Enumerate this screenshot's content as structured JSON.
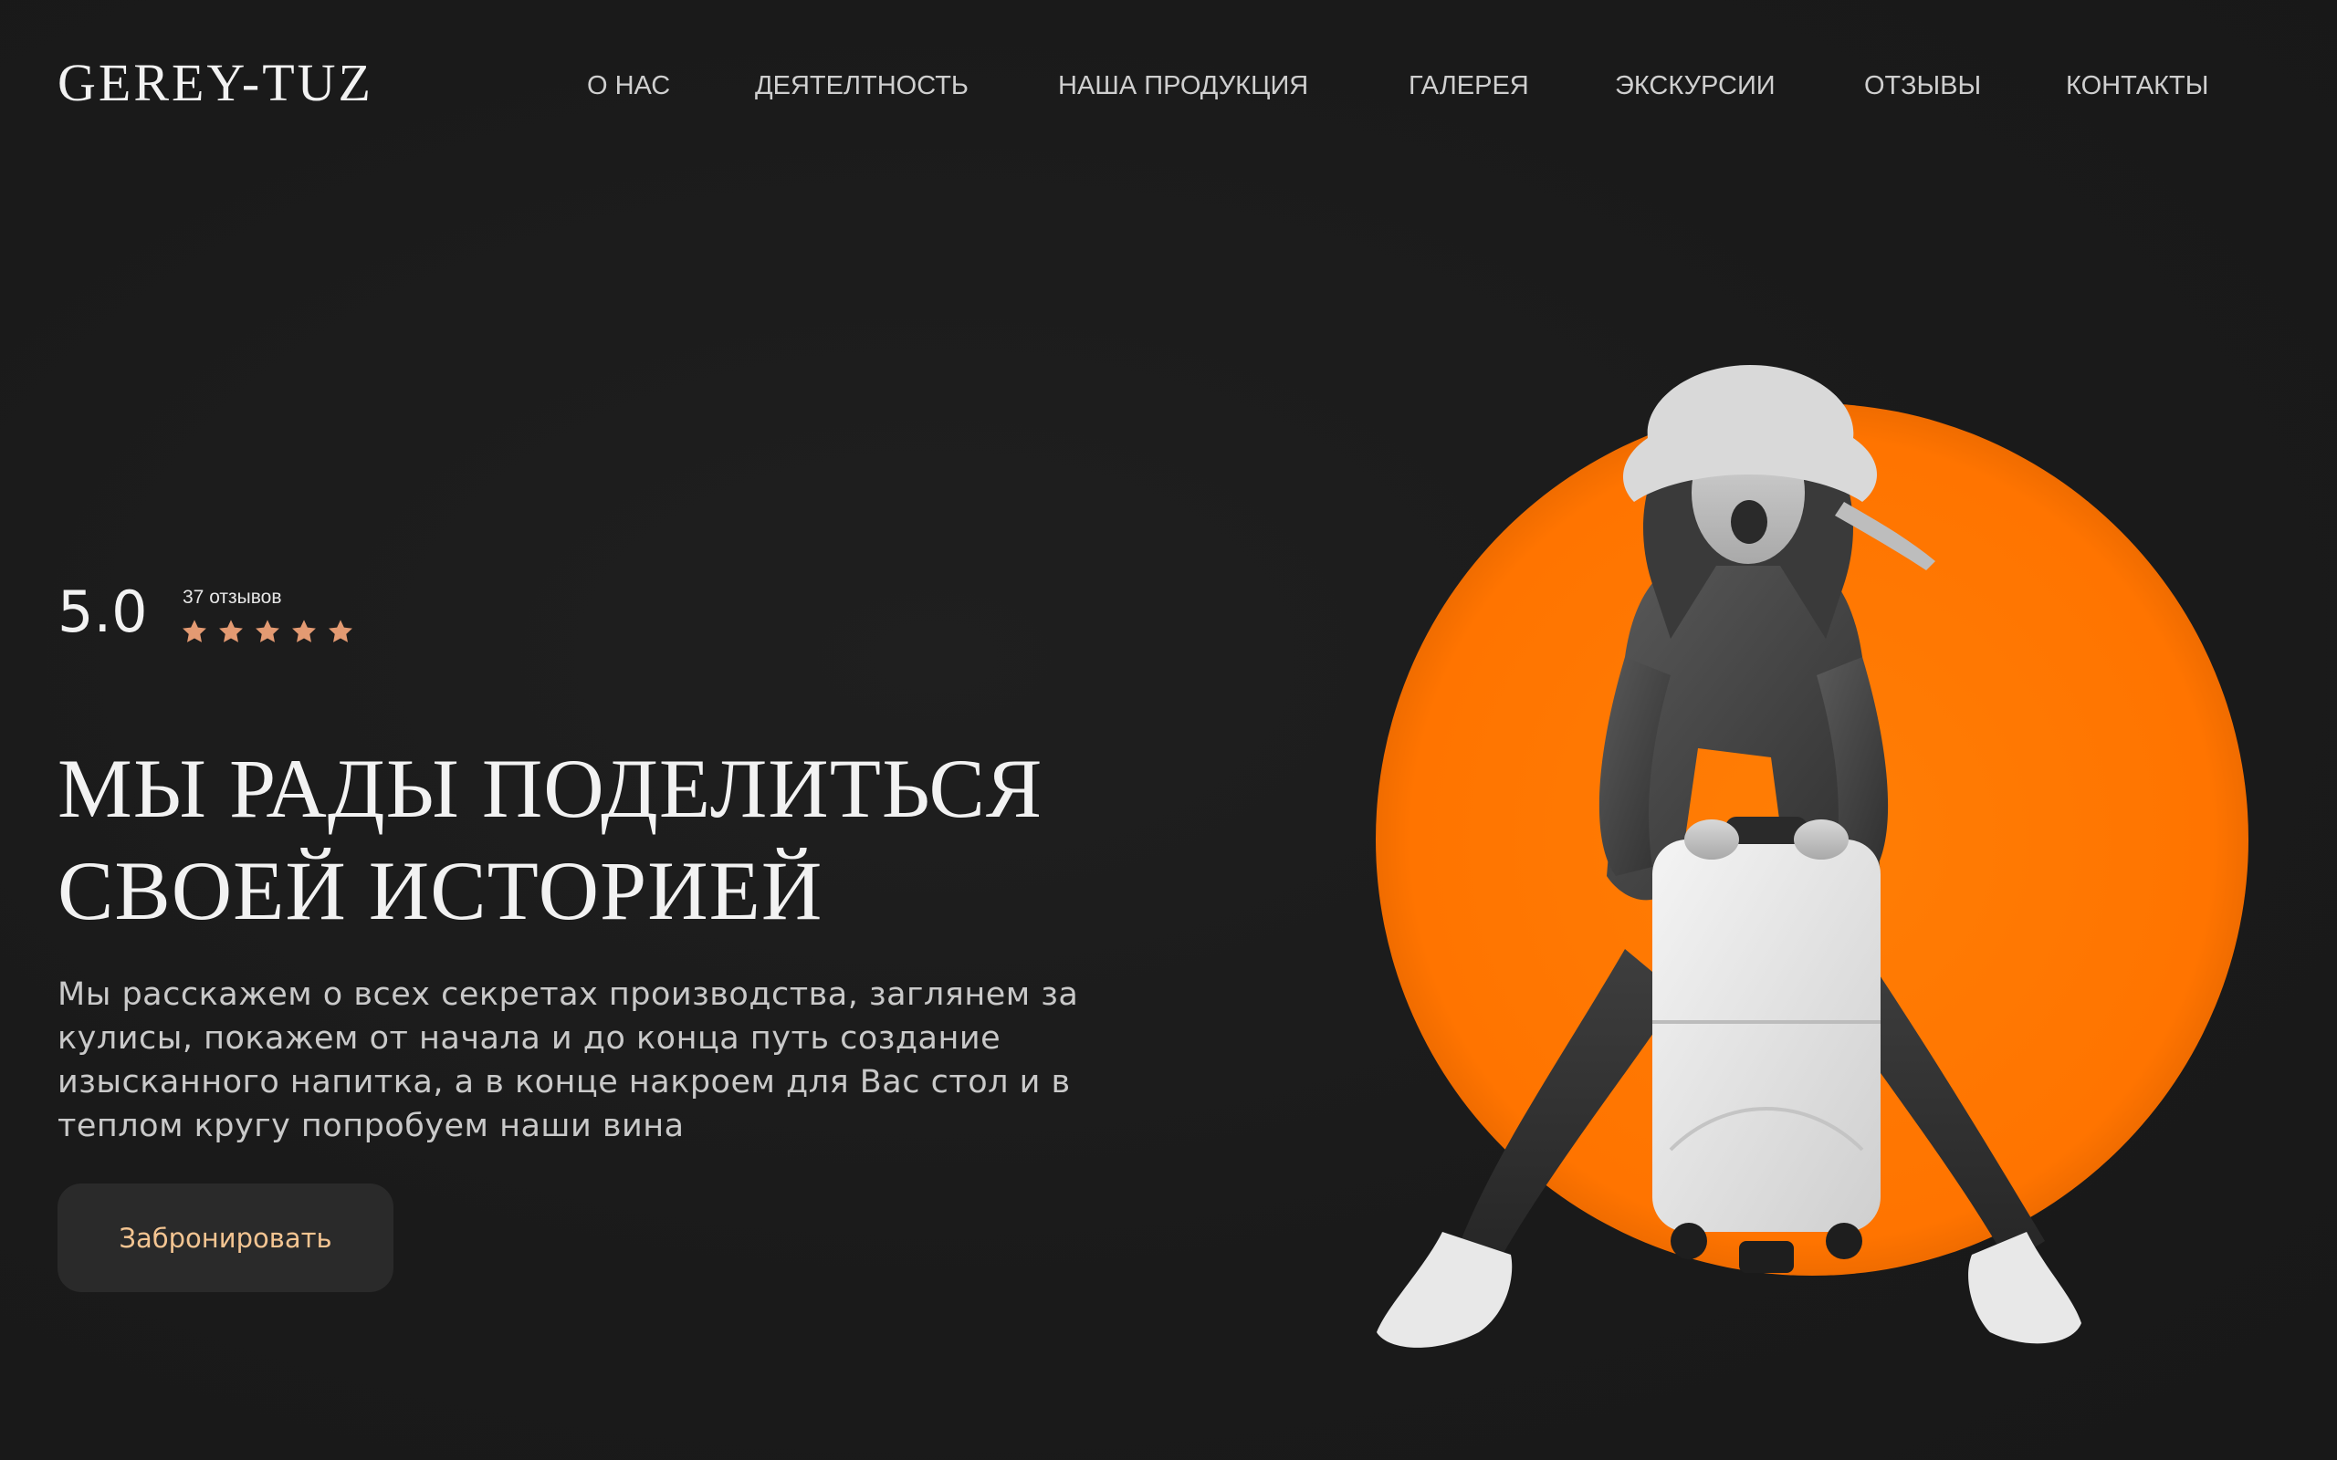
{
  "header": {
    "logo": "GEREY-TUZ",
    "nav": [
      {
        "label": "О НАС"
      },
      {
        "label": "ДЕЯТЕЛТНОСТЬ"
      },
      {
        "label": "НАША ПРОДУКЦИЯ"
      },
      {
        "label": "ГАЛЕРЕЯ"
      },
      {
        "label": "ЭКСКУРСИИ"
      },
      {
        "label": "ОТЗЫВЫ"
      },
      {
        "label": "КОНТАКТЫ"
      }
    ]
  },
  "rating": {
    "score": "5.0",
    "reviews": "37 отзывов",
    "stars": 5
  },
  "hero": {
    "headline_line1": "МЫ РАДЫ ПОДЕЛИТЬСЯ",
    "headline_line2": "СВОЕЙ ИСТОРИЕЙ",
    "description": "Мы расскажем о всех секретах производства, заглянем за кулисы, покажем от начала и до конца путь создание изысканного напитка, а в конце накроем для Вас стол и в теплом кругу попробуем наши вина",
    "button_label": "Забронировать"
  },
  "colors": {
    "background": "#1c1c1c",
    "accent_orange": "#ff7a00",
    "star": "#e39a72",
    "button_text": "#f4c592"
  }
}
